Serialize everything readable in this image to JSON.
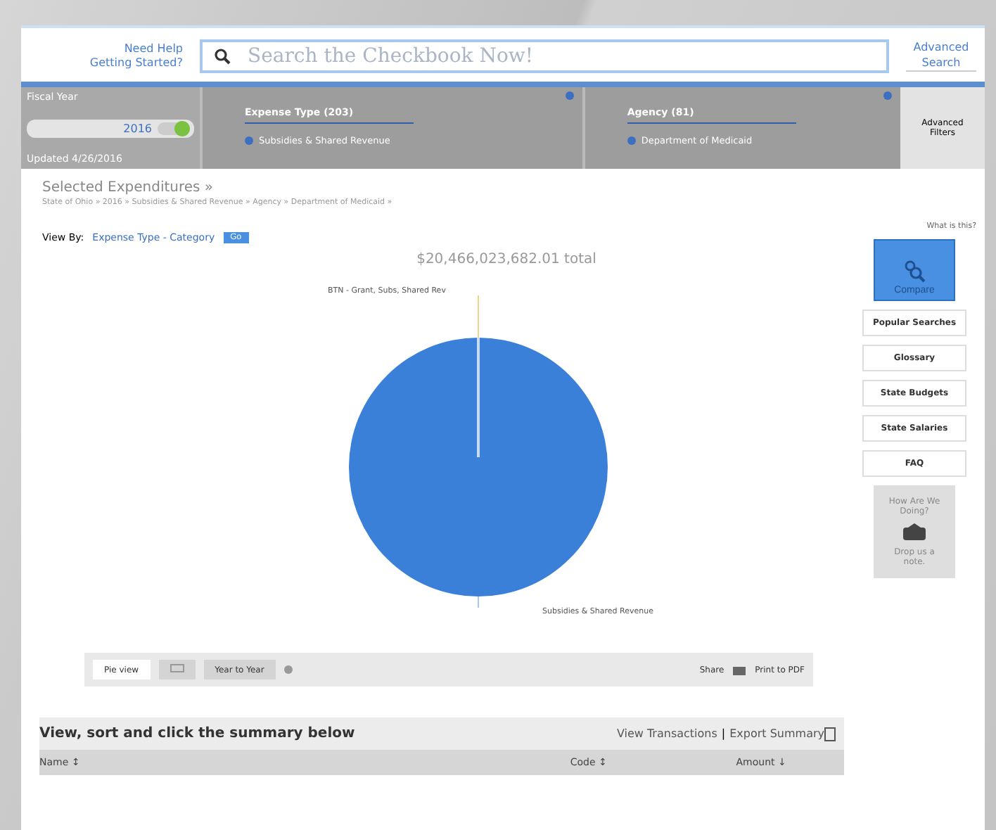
{
  "help": {
    "line1": "Need Help",
    "line2": "Getting Started?"
  },
  "search": {
    "placeholder": "Search the Checkbook Now!"
  },
  "advanced_search": "Advanced Search",
  "filters": {
    "fiscal_year": {
      "label": "Fiscal Year",
      "value": "2016",
      "on": true,
      "note": "Updated 4/26/2016"
    },
    "panels": [
      {
        "title": "Expense Type",
        "count": "(203)",
        "value": "Subsidies & Shared Revenue"
      },
      {
        "title": "Agency",
        "count": "(81)",
        "value": "Department of Medicaid"
      }
    ],
    "advanced_filters": "Advanced Filters"
  },
  "heading": "Selected Expenditures »",
  "breadcrumb": "State of Ohio » 2016 » Subsidies & Shared Revenue » Agency » Department of Medicaid »",
  "view_by": {
    "label": "View By:",
    "value": "Expense Type - Category",
    "button": "Go"
  },
  "total": "$20,466,023,682.01 total",
  "chart_labels": {
    "top": "BTN - Grant, Subs, Shared Rev",
    "bottom": "Subsidies & Shared Revenue"
  },
  "view_tabs": [
    {
      "kind": "text",
      "label": "Pie view",
      "selected": true
    },
    {
      "kind": "icon",
      "selected": false
    },
    {
      "kind": "text",
      "label": "Year to Year",
      "selected": false
    }
  ],
  "share": "Share",
  "print": "Print to PDF",
  "summary": {
    "title": "View, sort and click the summary below",
    "links": [
      "View Transactions",
      "Export Summary"
    ],
    "separator": "|",
    "columns": [
      {
        "label": "Name",
        "sort": "↕"
      },
      {
        "label": "Code",
        "sort": "↕"
      },
      {
        "label": "Amount",
        "sort": "↓"
      }
    ]
  },
  "sidebar": {
    "help": "What is this?",
    "compare": "Compare",
    "links": [
      "Popular Searches",
      "Glossary",
      "State Budgets",
      "State Salaries",
      "FAQ"
    ],
    "feedback": {
      "title": "How Are We Doing?",
      "action": "Drop us a note."
    }
  }
}
